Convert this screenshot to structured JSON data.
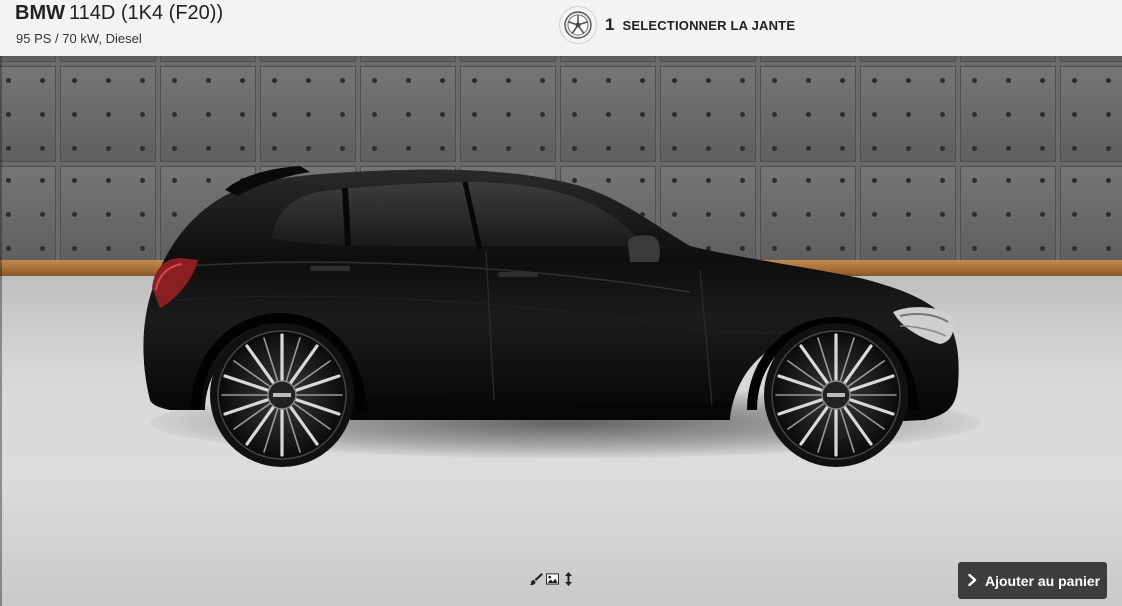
{
  "vehicle": {
    "brand": "BMW",
    "model": "114D (1K4 (F20))",
    "specs": "95 PS / 70 kW, Diesel",
    "paint_color": "#0d0d0d"
  },
  "step": {
    "number": "1",
    "label": "SELECTIONNER LA JANTE",
    "icon": "wheel-rim-icon"
  },
  "view_tools": [
    {
      "icon": "paintbrush-icon"
    },
    {
      "icon": "image-icon"
    },
    {
      "icon": "vertical-arrows-icon"
    }
  ],
  "cart": {
    "label": "Ajouter au panier",
    "icon": "chevron-right-icon",
    "color": "#3d3d3d"
  }
}
